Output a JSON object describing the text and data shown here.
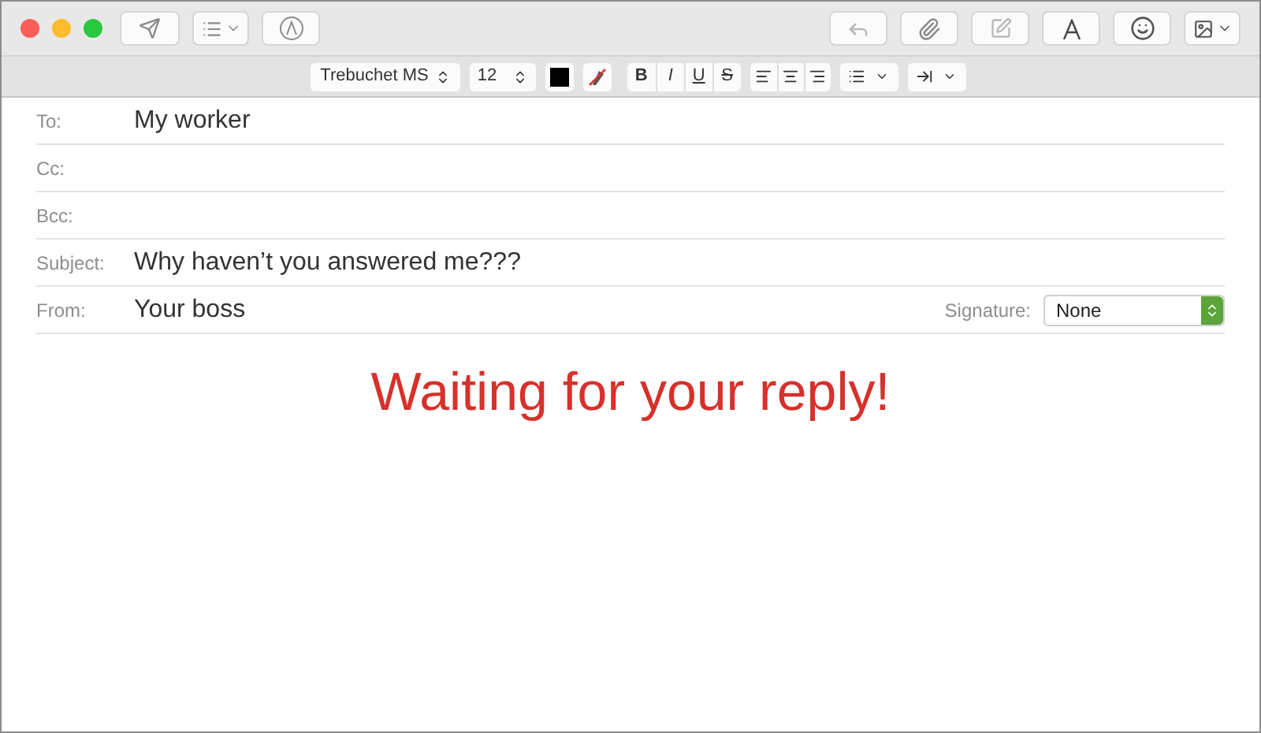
{
  "format_bar": {
    "font": "Trebuchet MS",
    "size": "12",
    "styles": [
      {
        "kind": "bold",
        "label": "B"
      },
      {
        "kind": "italic",
        "label": "I"
      },
      {
        "kind": "underline",
        "label": "U"
      },
      {
        "kind": "strike",
        "label": "S"
      }
    ]
  },
  "header_fields": [
    {
      "label": "To:",
      "value": "My worker"
    },
    {
      "label": "Cc:"
    },
    {
      "label": "Bcc:"
    },
    {
      "label": "Subject:",
      "value": "Why haven’t you answered me???"
    },
    {
      "label": "From:",
      "value": "Your boss"
    }
  ],
  "signature": {
    "label": "Signature:",
    "value": "None"
  },
  "body": {
    "text": "Waiting for your reply!"
  }
}
